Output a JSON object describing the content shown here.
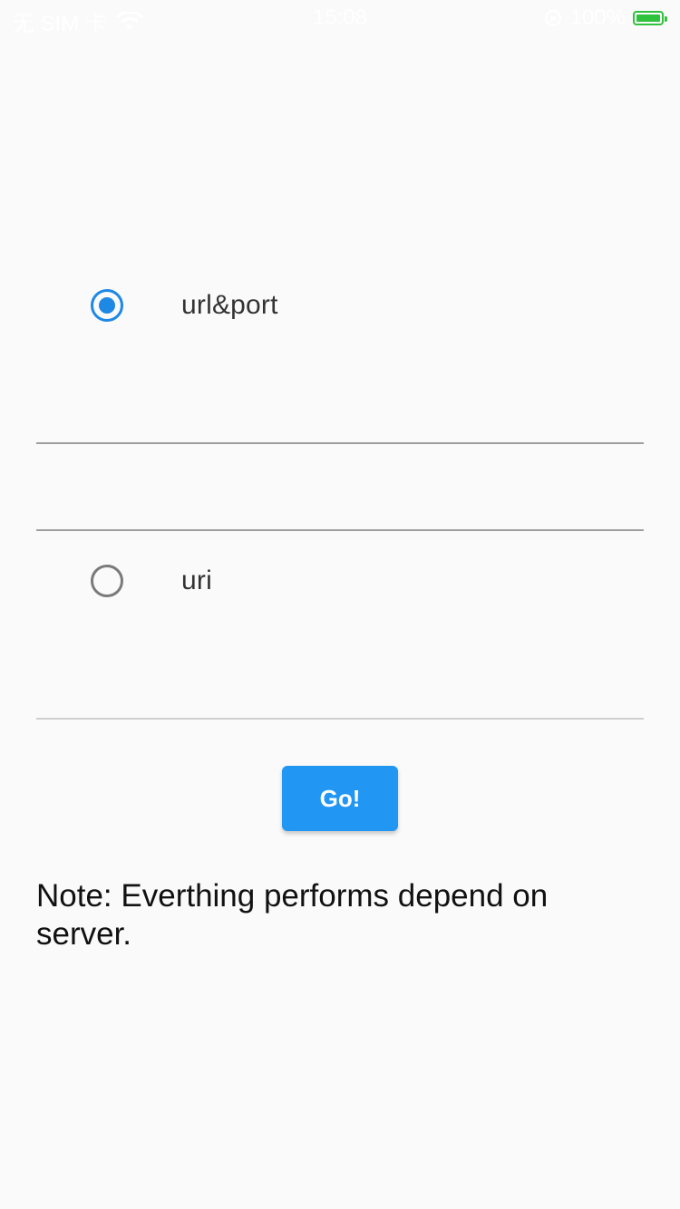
{
  "status_bar": {
    "carrier": "无 SIM 卡",
    "time": "15:08",
    "battery_text": "100%",
    "battery_color": "#2fc23d"
  },
  "options": {
    "url_port": {
      "label": "url&port",
      "checked": true
    },
    "uri": {
      "label": "uri",
      "checked": false
    }
  },
  "fields": {
    "url_value": "",
    "port_value": "",
    "uri_value": ""
  },
  "go_button": {
    "label": "Go!",
    "color": "#2196f3"
  },
  "note": "Note: Everthing performs depend on server.",
  "colors": {
    "radio_selected": "#1e88e5",
    "radio_unselected": "#7a7a7a",
    "background": "#fafafa"
  }
}
